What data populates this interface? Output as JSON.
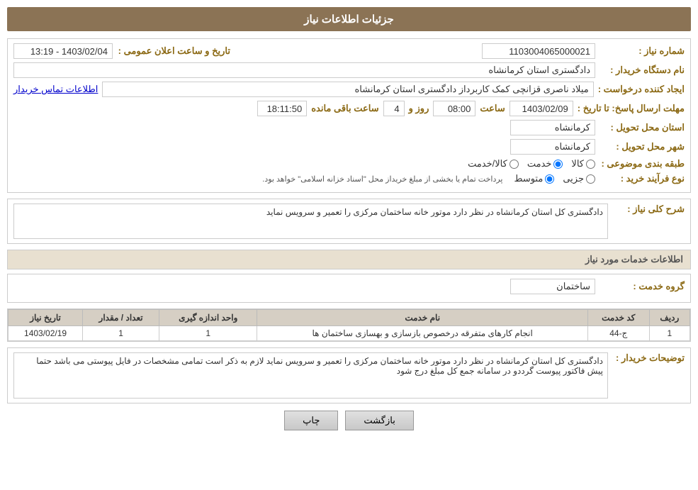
{
  "page": {
    "title": "جزئیات اطلاعات نیاز",
    "header": {
      "label": "جزئیات اطلاعات نیاز"
    },
    "fields": {
      "need_number_label": "شماره نیاز :",
      "need_number_value": "1103004065000021",
      "buyer_org_label": "نام دستگاه خریدار :",
      "buyer_org_value": "دادگستری استان کرمانشاه",
      "announce_date_label": "تاریخ و ساعت اعلان عمومی :",
      "announce_date_value": "1403/02/04 - 13:19",
      "creator_label": "ایجاد کننده درخواست :",
      "creator_value": "میلاد ناصری قزانچی کمک کاربرداز دادگستری استان کرمانشاه",
      "contact_link": "اطلاعات تماس خریدار",
      "reply_deadline_label": "مهلت ارسال پاسخ: تا تاریخ :",
      "reply_date": "1403/02/09",
      "reply_time_label": "ساعت",
      "reply_time": "08:00",
      "reply_days_label": "روز و",
      "reply_days": "4",
      "remaining_label": "ساعت باقی مانده",
      "remaining_time": "18:11:50",
      "province_label": "استان محل تحویل :",
      "province_value": "کرمانشاه",
      "city_label": "شهر محل تحویل :",
      "city_value": "کرمانشاه",
      "category_label": "طبقه بندی موضوعی :",
      "category_options": [
        "کالا",
        "خدمت",
        "کالا/خدمت"
      ],
      "category_selected": "خدمت",
      "purchase_type_label": "نوع فرآیند خرید :",
      "purchase_types": [
        "جزیی",
        "متوسط"
      ],
      "purchase_selected": "متوسط",
      "purchase_note": "پرداخت تمام یا بخشی از مبلغ خریداز محل \"اسناد خزانه اسلامی\" خواهد بود.",
      "need_desc_label": "شرح کلی نیاز :",
      "need_desc_value": "دادگستری کل استان کرمانشاه در نظر دارد موتور خانه ساختمان مرکزی را تعمیر و سرویس نماید",
      "services_header": "اطلاعات خدمات مورد نیاز",
      "service_group_label": "گروه خدمت :",
      "service_group_value": "ساختمان",
      "table": {
        "columns": [
          "ردیف",
          "کد خدمت",
          "نام خدمت",
          "واحد اندازه گیری",
          "تعداد / مقدار",
          "تاریخ نیاز"
        ],
        "rows": [
          {
            "row_num": "1",
            "service_code": "ج-44",
            "service_name": "انجام کارهای متفرقه درخصوص بازسازی و بهسازی ساختمان ها",
            "unit": "1",
            "quantity": "1",
            "date": "1403/02/19"
          }
        ]
      },
      "buyer_desc_label": "توضیحات خریدار :",
      "buyer_desc_value": "دادگستری کل استان کرمانشاه در نظر دارد موتور خانه ساختمان مرکزی را تعمیر و سرویس نماید لازم به ذکر است تمامی مشخصات در فایل پیوستی می باشد حتما پیش فاکتور پیوست گرددو در سامانه جمع کل مبلغ درج شود",
      "buttons": {
        "print": "چاپ",
        "back": "بازگشت"
      }
    }
  }
}
